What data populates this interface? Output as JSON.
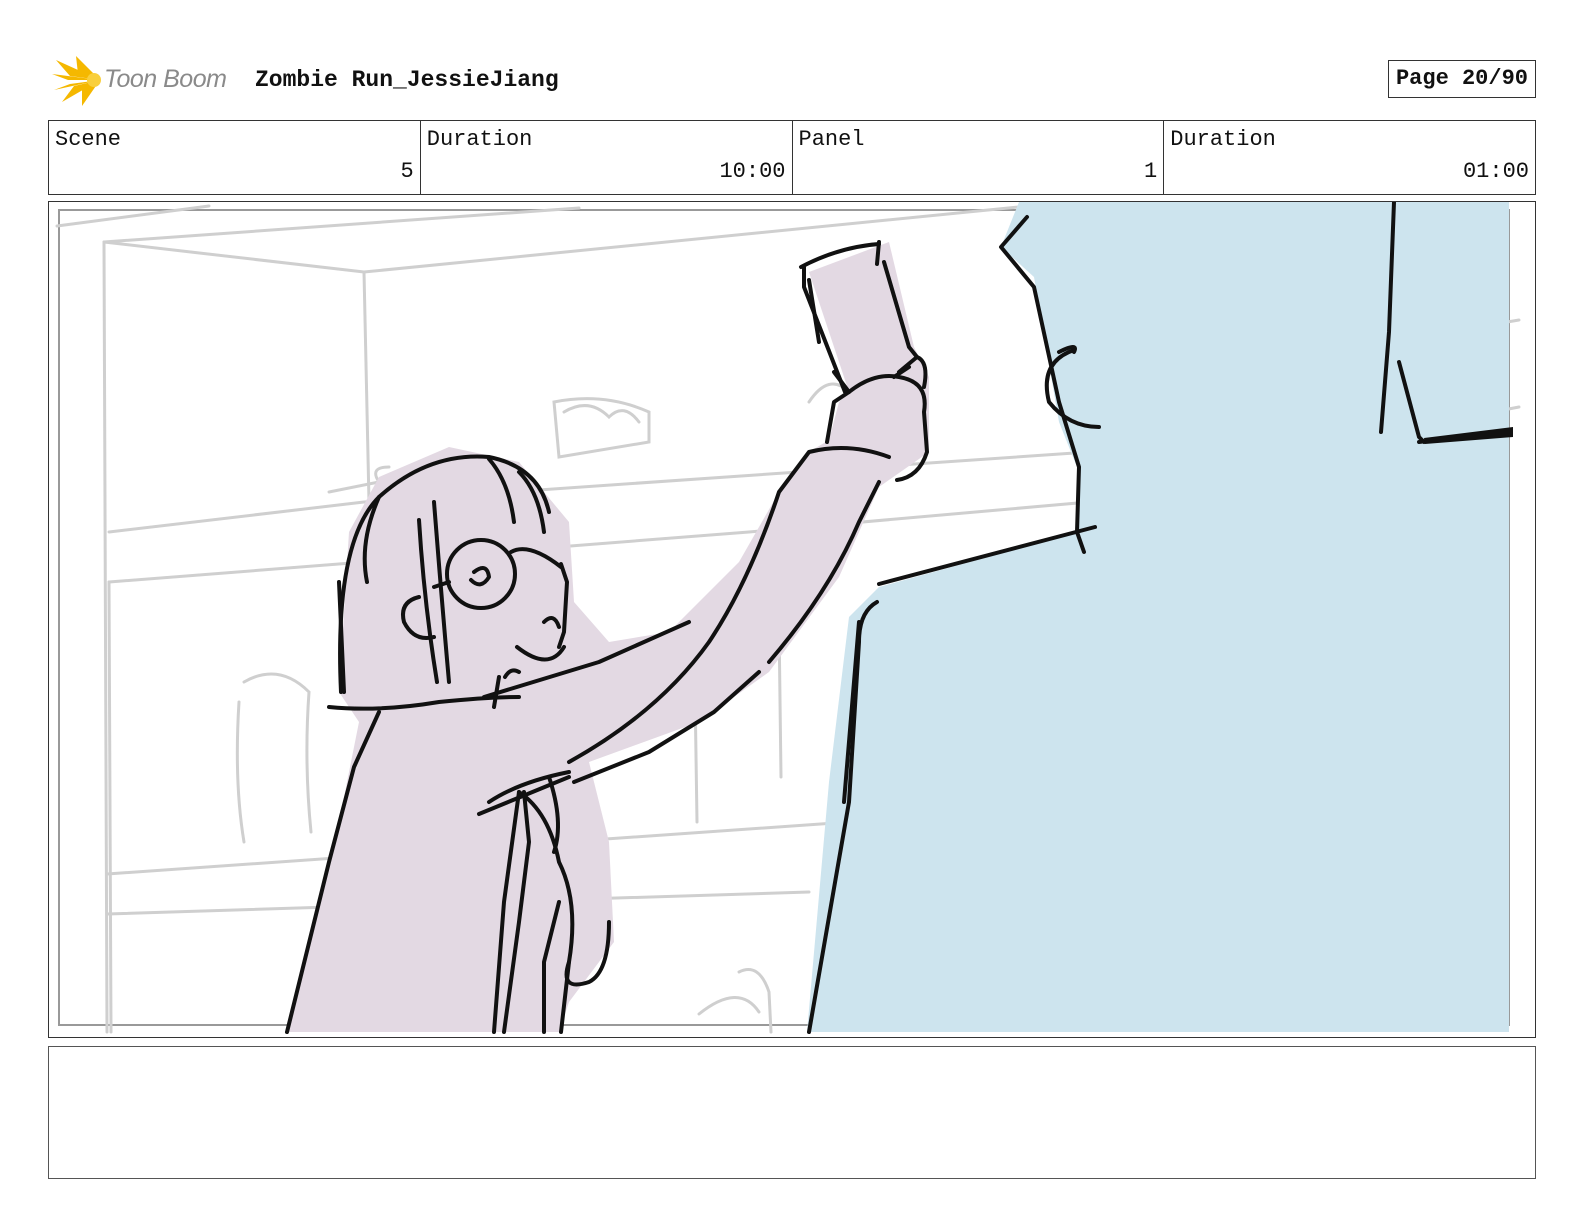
{
  "header": {
    "logo_text": "Toon Boom",
    "project_title": "Zombie Run_JessieJiang",
    "page_label": "Page 20/90"
  },
  "info": {
    "scene_label": "Scene",
    "scene_value": "5",
    "scene_duration_label": "Duration",
    "scene_duration_value": "10:00",
    "panel_label": "Panel",
    "panel_value": "1",
    "panel_duration_label": "Duration",
    "panel_duration_value": "01:00"
  },
  "colors": {
    "logo_yellow": "#f5b800",
    "girl_fill": "#e3d9e3",
    "figure_fill": "#cde4ee",
    "sketch_grey": "#cccccc",
    "ink": "#111111"
  },
  "notes": {
    "text": ""
  }
}
